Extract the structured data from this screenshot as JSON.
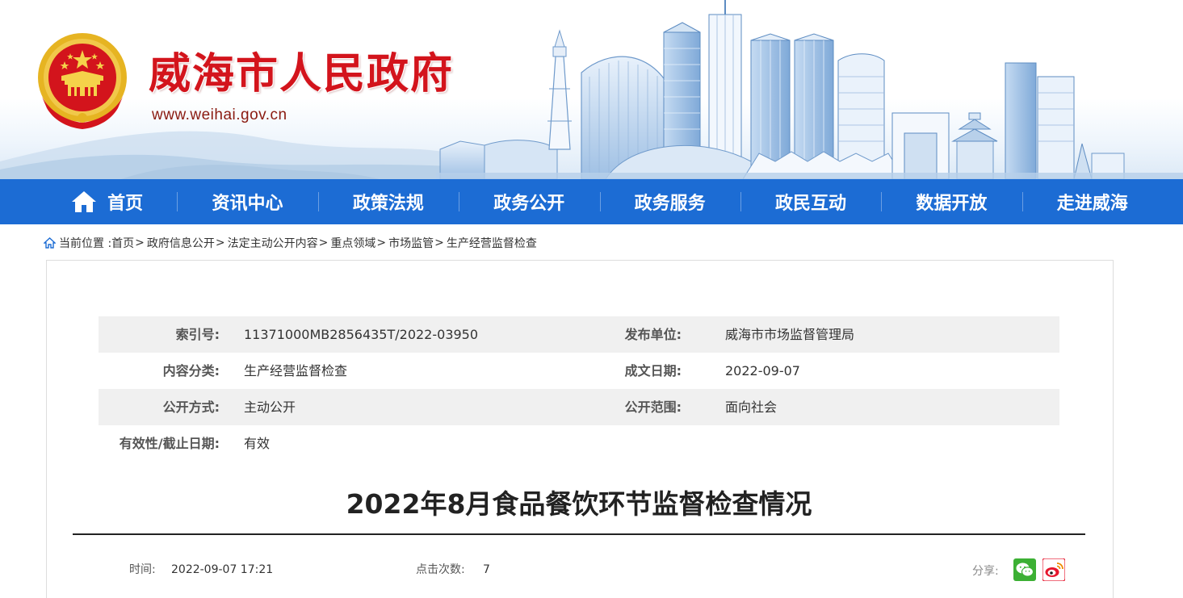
{
  "site": {
    "title": "威海市人民政府",
    "url": "www.weihai.gov.cn"
  },
  "nav": {
    "items": [
      {
        "label": "首页",
        "icon": "home-icon"
      },
      {
        "label": "资讯中心"
      },
      {
        "label": "政策法规"
      },
      {
        "label": "政务公开"
      },
      {
        "label": "政务服务"
      },
      {
        "label": "政民互动"
      },
      {
        "label": "数据开放"
      },
      {
        "label": "走进威海"
      }
    ]
  },
  "breadcrumb": {
    "prefix": "当前位置 :",
    "items": [
      "首页",
      "政府信息公开",
      "法定主动公开内容",
      "重点领域",
      "市场监管",
      "生产经营监督检查"
    ],
    "separator": ">"
  },
  "meta": {
    "rows": [
      {
        "label1": "索引号:",
        "value1": "11371000MB2856435T/2022-03950",
        "label2": "发布单位:",
        "value2": "威海市市场监督管理局"
      },
      {
        "label1": "内容分类:",
        "value1": "生产经营监督检查",
        "label2": "成文日期:",
        "value2": "2022-09-07"
      },
      {
        "label1": "公开方式:",
        "value1": "主动公开",
        "label2": "公开范围:",
        "value2": "面向社会"
      },
      {
        "label1": "有效性/截止日期:",
        "value1": "有效",
        "label2": "",
        "value2": ""
      }
    ]
  },
  "article": {
    "title": "2022年8月食品餐饮环节监督检查情况",
    "time_label": "时间:",
    "time_value": "2022-09-07 17:21",
    "clicks_label": "点击次数:",
    "clicks_value": "7",
    "share_label": "分享:"
  },
  "share": {
    "buttons": [
      "wechat-icon",
      "weibo-icon"
    ]
  },
  "colors": {
    "nav_bg": "#1c6cd4",
    "title_red": "#d3141c",
    "meta_shade": "#f0f0f0"
  }
}
